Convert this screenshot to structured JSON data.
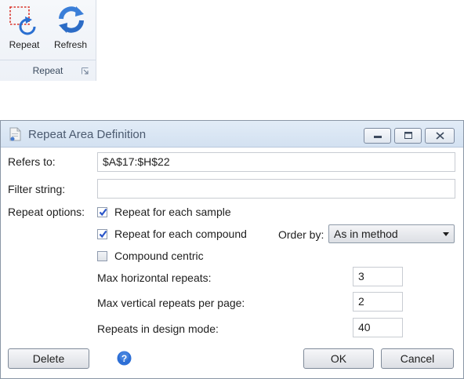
{
  "ribbon": {
    "repeat_button_label": "Repeat",
    "refresh_button_label": "Refresh",
    "group_label": "Repeat"
  },
  "dialog": {
    "title": "Repeat Area Definition",
    "refers_to_label": "Refers to:",
    "refers_to_value": "$A$17:$H$22",
    "filter_string_label": "Filter string:",
    "filter_string_value": "",
    "repeat_options_label": "Repeat options:",
    "options": {
      "repeat_each_sample": {
        "label": "Repeat for each sample",
        "checked": true
      },
      "repeat_each_compound": {
        "label": "Repeat for each compound",
        "checked": true
      },
      "compound_centric": {
        "label": "Compound centric",
        "checked": false
      }
    },
    "order_by_label": "Order by:",
    "order_by_value": "As in method",
    "max_horizontal_label": "Max horizontal repeats:",
    "max_horizontal_value": "3",
    "max_vertical_label": "Max vertical repeats per page:",
    "max_vertical_value": "2",
    "design_mode_label": "Repeats in design mode:",
    "design_mode_value": "40",
    "delete_label": "Delete",
    "ok_label": "OK",
    "cancel_label": "Cancel"
  },
  "colors": {
    "titlebar": "#d3e1f1",
    "check": "#2a55c9",
    "help_icon": "#2d6fd6"
  }
}
